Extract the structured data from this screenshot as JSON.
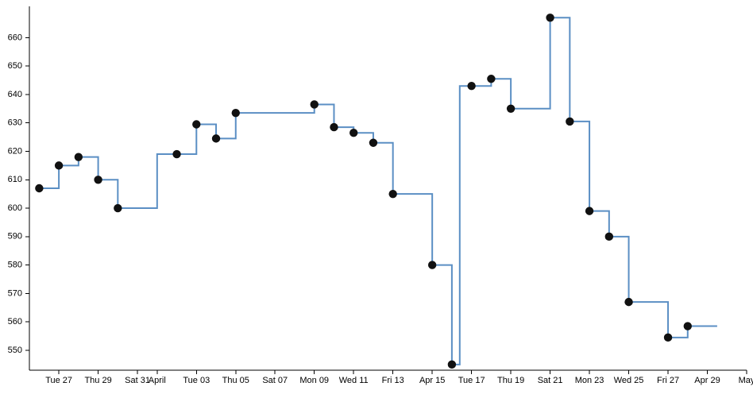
{
  "chart_data": {
    "type": "line",
    "subtype": "step-post",
    "title": "",
    "subtitle": "",
    "xlabel": "",
    "ylabel": "",
    "grid": false,
    "legend": null,
    "legend_position": "none",
    "series_color": "#5b8fc4",
    "marker_color": "#111111",
    "axis_color": "#000000",
    "background": "#ffffff",
    "ylim": [
      543,
      671
    ],
    "y_ticks": [
      550,
      560,
      570,
      580,
      590,
      600,
      610,
      620,
      630,
      640,
      650,
      660
    ],
    "y_tick_labels": [
      "550",
      "560",
      "570",
      "580",
      "590",
      "600",
      "610",
      "620",
      "630",
      "640",
      "650",
      "660"
    ],
    "x_ticks": [
      27,
      29,
      31,
      32,
      34,
      36,
      38,
      40,
      42,
      44,
      46,
      48,
      50,
      52,
      54,
      56,
      58,
      60
    ],
    "x_tick_labels": [
      "Tue 27",
      "Thu 29",
      "Sat 31",
      "April",
      "Tue 03",
      "Thu 05",
      "Sat 07",
      "Mon 09",
      "Wed 11",
      "Fri 13",
      "Apr 15",
      "Tue 17",
      "Thu 19",
      "Sat 21",
      "Mon 23",
      "Wed 25",
      "Fri 27",
      "Apr 29"
    ],
    "x_end_tick": 62,
    "x_end_tick_label": "May",
    "xlim": [
      25.5,
      62
    ],
    "x": [
      26,
      27,
      28,
      29,
      30,
      32,
      33,
      34,
      35,
      36,
      37,
      38,
      40,
      41,
      42,
      43,
      44,
      45,
      46,
      47,
      49,
      50,
      51,
      52,
      53,
      54,
      55,
      56,
      57,
      58,
      59,
      60,
      61
    ],
    "values": [
      607,
      615,
      618,
      610,
      600,
      619,
      629.5,
      624.5,
      633.5,
      633.5,
      636.5,
      628.5,
      626.5,
      623,
      605,
      580,
      545,
      643,
      645.5,
      635,
      667,
      630.5,
      599,
      590,
      567,
      554.5,
      558.5,
      558.5,
      558.5,
      558.5,
      558.5,
      558.5,
      558.5
    ],
    "points": [
      {
        "x": 26,
        "y": 607,
        "marker": true
      },
      {
        "x": 27,
        "y": 615,
        "marker": true
      },
      {
        "x": 28,
        "y": 618,
        "marker": true
      },
      {
        "x": 29,
        "y": 610,
        "marker": true
      },
      {
        "x": 30,
        "y": 600,
        "marker": true
      },
      {
        "x": 32,
        "y": 619,
        "marker": false
      },
      {
        "x": 33,
        "y": 619,
        "marker": true
      },
      {
        "x": 34,
        "y": 629.5,
        "marker": true
      },
      {
        "x": 35,
        "y": 624.5,
        "marker": true
      },
      {
        "x": 36,
        "y": 633.5,
        "marker": true
      },
      {
        "x": 38,
        "y": 633.5,
        "marker": false
      },
      {
        "x": 40,
        "y": 636.5,
        "marker": true
      },
      {
        "x": 41,
        "y": 628.5,
        "marker": true
      },
      {
        "x": 42,
        "y": 626.5,
        "marker": true
      },
      {
        "x": 43,
        "y": 623,
        "marker": true
      },
      {
        "x": 44,
        "y": 605,
        "marker": true
      },
      {
        "x": 46,
        "y": 580,
        "marker": true
      },
      {
        "x": 47,
        "y": 545,
        "marker": true
      },
      {
        "x": 48,
        "y": 643,
        "marker": true
      },
      {
        "x": 49,
        "y": 645.5,
        "marker": true
      },
      {
        "x": 50,
        "y": 635,
        "marker": true
      },
      {
        "x": 52,
        "y": 667,
        "marker": true
      },
      {
        "x": 53,
        "y": 630.5,
        "marker": true
      },
      {
        "x": 54,
        "y": 599,
        "marker": true
      },
      {
        "x": 55,
        "y": 590,
        "marker": true
      },
      {
        "x": 56,
        "y": 567,
        "marker": true
      },
      {
        "x": 58,
        "y": 554.5,
        "marker": true
      },
      {
        "x": 59,
        "y": 558.5,
        "marker": true
      }
    ],
    "step_segments": [
      {
        "x0": 26,
        "x1": 27,
        "y": 607
      },
      {
        "x0": 27,
        "x1": 28,
        "y": 615
      },
      {
        "x0": 28,
        "x1": 29,
        "y": 618
      },
      {
        "x0": 29,
        "x1": 30,
        "y": 610
      },
      {
        "x0": 30,
        "x1": 32,
        "y": 600
      },
      {
        "x0": 32,
        "x1": 34,
        "y": 619
      },
      {
        "x0": 34,
        "x1": 35,
        "y": 629.5
      },
      {
        "x0": 35,
        "x1": 36,
        "y": 624.5
      },
      {
        "x0": 36,
        "x1": 40,
        "y": 633.5
      },
      {
        "x0": 40,
        "x1": 41,
        "y": 636.5
      },
      {
        "x0": 41,
        "x1": 42,
        "y": 628.5
      },
      {
        "x0": 42,
        "x1": 43,
        "y": 626.5
      },
      {
        "x0": 43,
        "x1": 44,
        "y": 623
      },
      {
        "x0": 44,
        "x1": 46,
        "y": 605
      },
      {
        "x0": 46,
        "x1": 47,
        "y": 580
      },
      {
        "x0": 47,
        "x1": 47.4,
        "y": 545
      },
      {
        "x0": 47.4,
        "x1": 49,
        "y": 643
      },
      {
        "x0": 49,
        "x1": 50,
        "y": 645.5
      },
      {
        "x0": 50,
        "x1": 52,
        "y": 635
      },
      {
        "x0": 52,
        "x1": 53,
        "y": 667
      },
      {
        "x0": 53,
        "x1": 54,
        "y": 630.5
      },
      {
        "x0": 54,
        "x1": 55,
        "y": 599
      },
      {
        "x0": 55,
        "x1": 56,
        "y": 590
      },
      {
        "x0": 56,
        "x1": 58,
        "y": 567
      },
      {
        "x0": 58,
        "x1": 59,
        "y": 554.5
      },
      {
        "x0": 59,
        "x1": 60.5,
        "y": 558.5
      }
    ]
  }
}
